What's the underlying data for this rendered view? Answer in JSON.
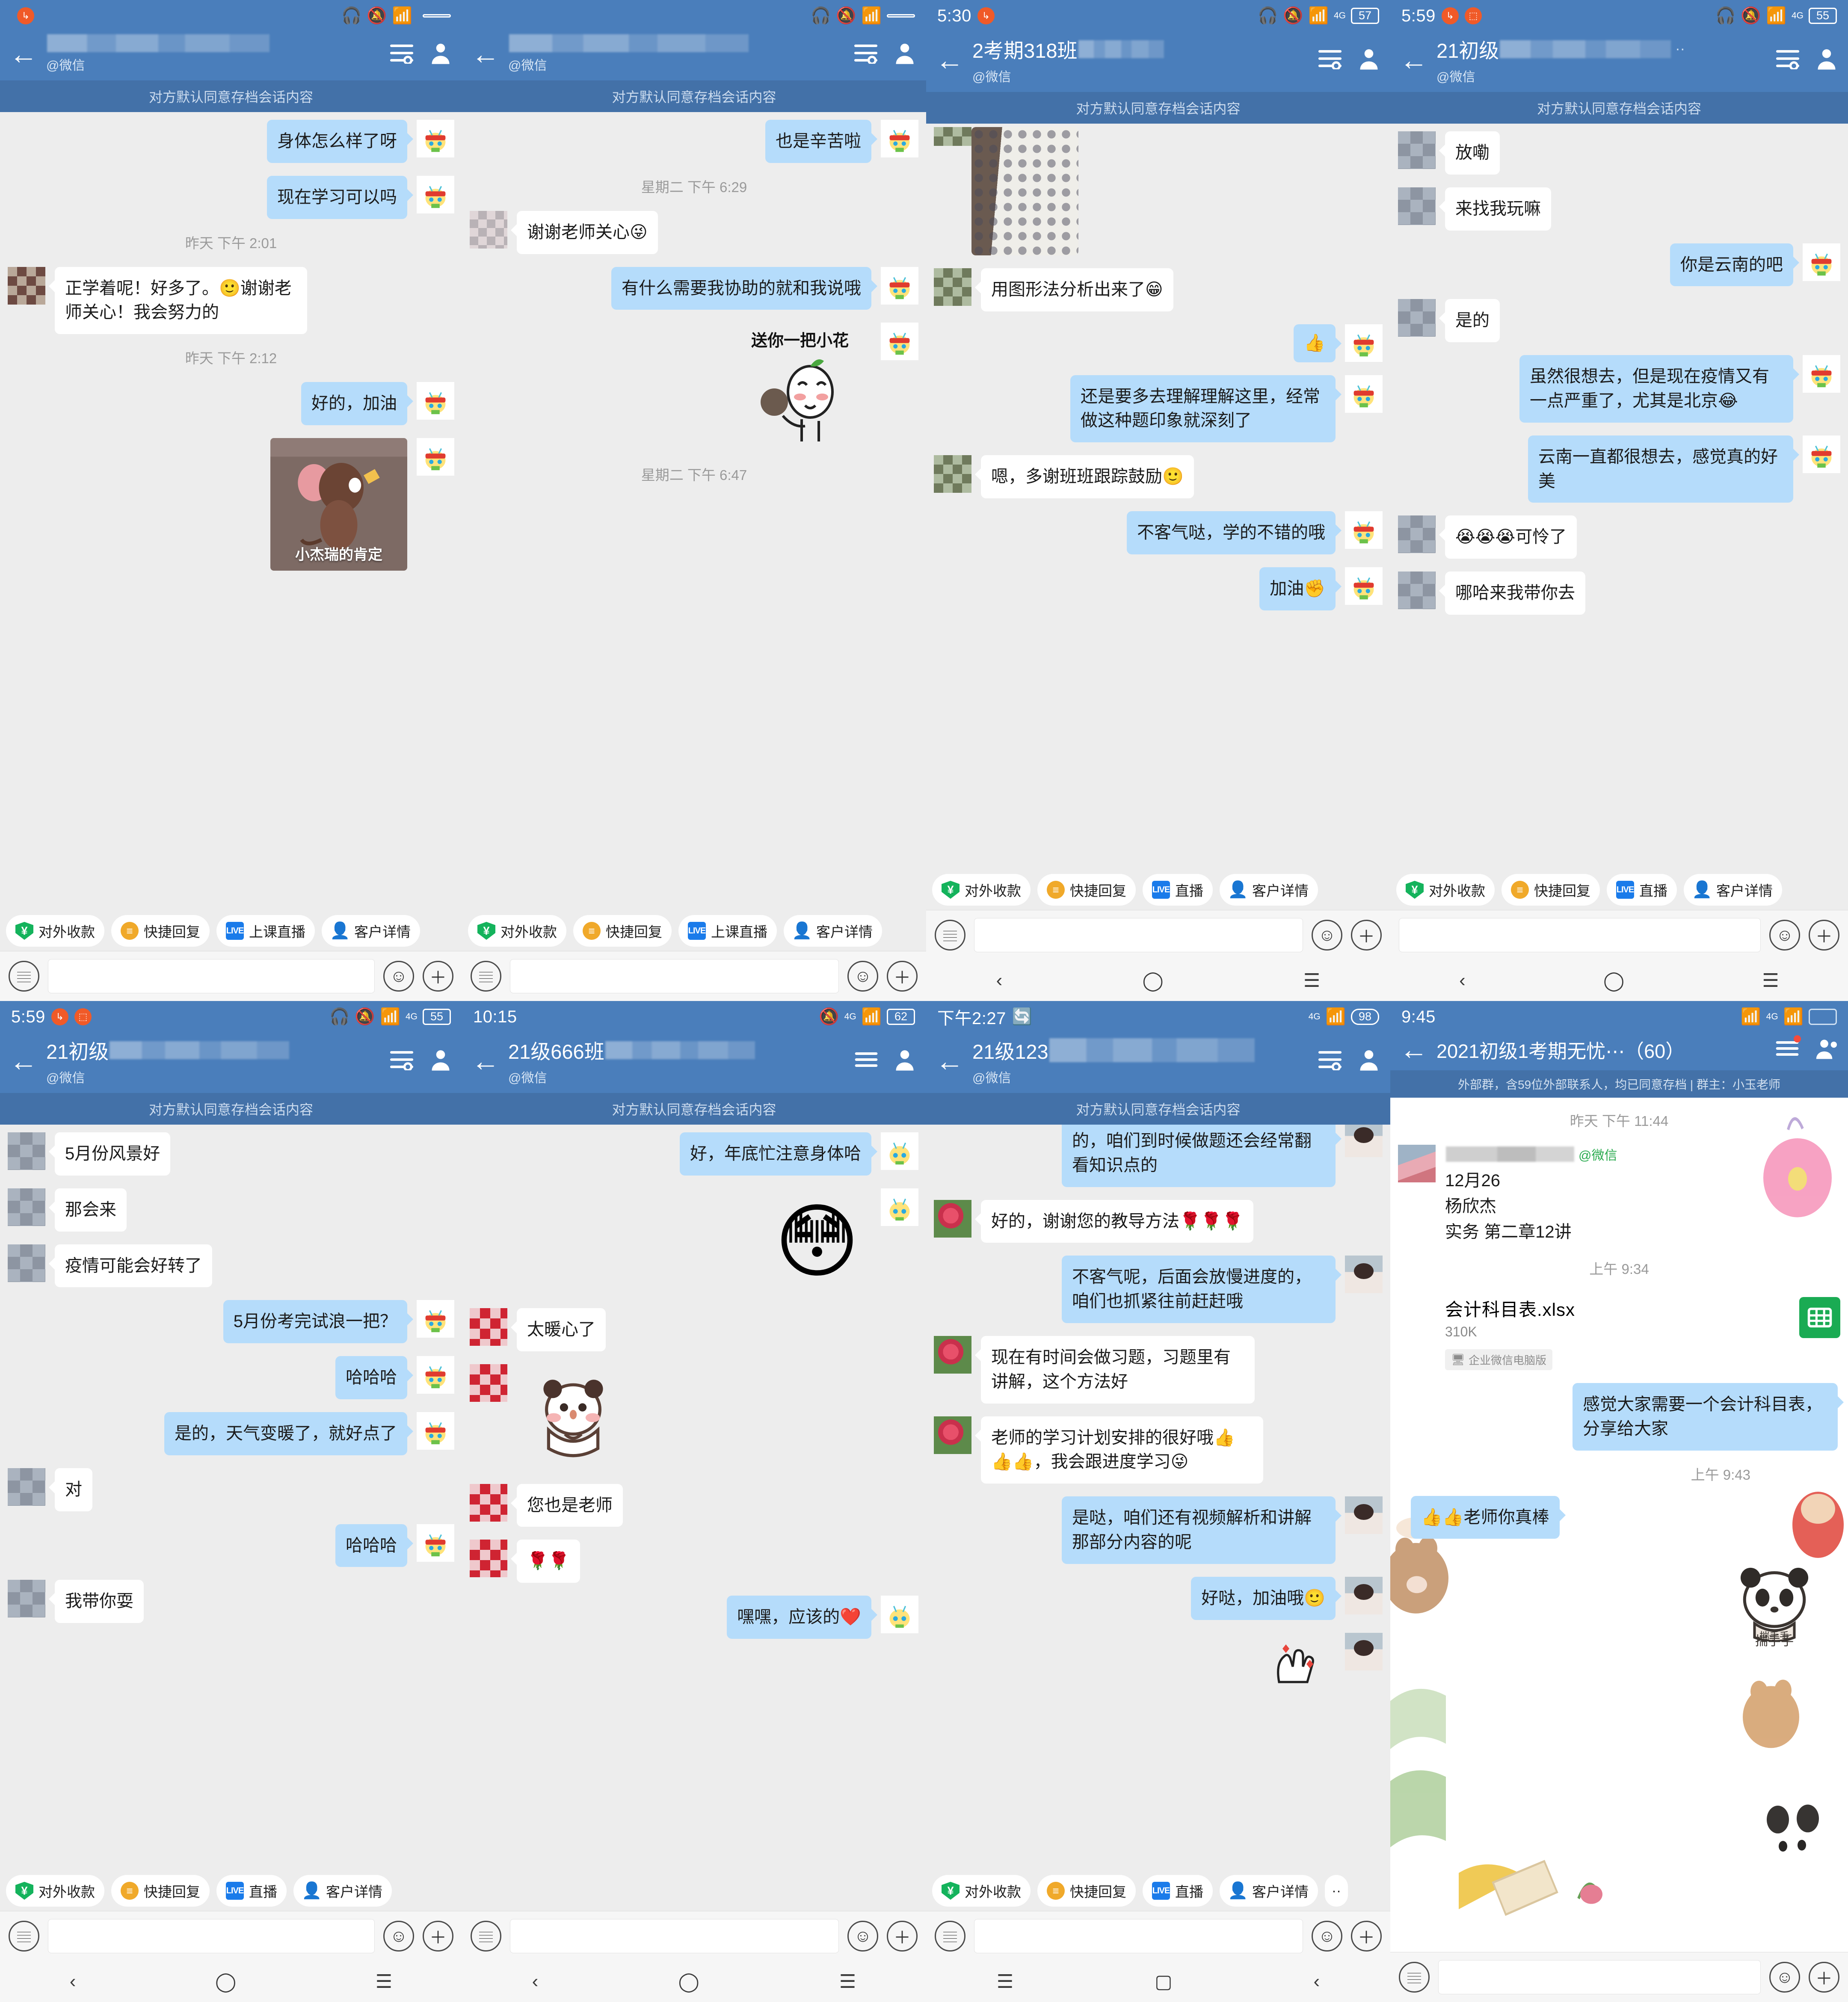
{
  "common": {
    "archive_notice": "对方默认同意存档会话内容",
    "org_handle": "@微信",
    "quick_actions": [
      {
        "label": "对外收款",
        "icon": "pay-shield-icon",
        "glyph": "¥"
      },
      {
        "label": "快捷回复",
        "icon": "quick-reply-icon",
        "glyph": "≡"
      },
      {
        "label": "上课直播",
        "icon": "live-icon",
        "glyph": "LIVE"
      },
      {
        "label": "客户详情",
        "icon": "customer-detail-icon",
        "glyph": "👤"
      }
    ],
    "quick_actions_short": [
      {
        "label": "对外收款",
        "icon": "pay-shield-icon",
        "glyph": "¥"
      },
      {
        "label": "快捷回复",
        "icon": "quick-reply-icon",
        "glyph": "≡"
      },
      {
        "label": "直播",
        "icon": "live-icon",
        "glyph": "LIVE"
      },
      {
        "label": "客户详情",
        "icon": "customer-detail-icon",
        "glyph": "👤"
      }
    ],
    "input_placeholder": "",
    "colors": {
      "header_blue": "#4a7ebb",
      "archive_blue": "#4371a8",
      "out_bubble": "#b5dcfb",
      "in_bubble": "#ffffff",
      "chat_bg": "#ededed",
      "accent_orange": "#f05a28",
      "pay_green": "#14b35c",
      "quick_yellow": "#f0a92a",
      "live_blue": "#1a7bea",
      "file_green": "#1aab53"
    }
  },
  "panels": [
    {
      "id": "panel-1",
      "status": {
        "time": "",
        "battery": "",
        "network": ""
      },
      "title": "",
      "subtitle": "@微信",
      "messages": [
        {
          "dir": "out",
          "type": "text",
          "text": "身体怎么样了呀"
        },
        {
          "dir": "out",
          "type": "text",
          "text": "现在学习可以吗"
        },
        {
          "type": "time",
          "text": "昨天  下午 2:01"
        },
        {
          "dir": "in",
          "type": "text",
          "text": "正学着呢！好多了。🙂谢谢老师关心！我会努力的"
        },
        {
          "type": "time",
          "text": "昨天  下午 2:12"
        },
        {
          "dir": "out",
          "type": "text",
          "text": "好的，加油"
        },
        {
          "dir": "out",
          "type": "image",
          "caption": "小杰瑞的肯定"
        }
      ]
    },
    {
      "id": "panel-2",
      "status": {
        "time": "",
        "battery": "",
        "network": ""
      },
      "title": "",
      "subtitle": "@微信",
      "messages": [
        {
          "dir": "out",
          "type": "text",
          "text": "也是辛苦啦"
        },
        {
          "type": "time",
          "text": "星期二  下午 6:29"
        },
        {
          "dir": "in",
          "type": "text",
          "text": "谢谢老师关心😜"
        },
        {
          "dir": "out",
          "type": "text",
          "text": "有什么需要我协助的就和我说哦"
        },
        {
          "dir": "out",
          "type": "sticker",
          "caption": "送你一把小花"
        },
        {
          "type": "time",
          "text": "星期二  下午 6:47"
        }
      ]
    },
    {
      "id": "panel-3",
      "status": {
        "time": "5:30",
        "battery": "57",
        "network": "4G"
      },
      "title": "2考期318班",
      "subtitle": "@微信",
      "messages": [
        {
          "dir": "in",
          "type": "photo"
        },
        {
          "dir": "in",
          "type": "text",
          "text": "用图形法分析出来了😁"
        },
        {
          "dir": "out",
          "type": "text",
          "text": "👍"
        },
        {
          "dir": "out",
          "type": "text",
          "text": "还是要多去理解理解这里，经常做这种题印象就深刻了"
        },
        {
          "dir": "in",
          "type": "text",
          "text": "嗯，多谢班班跟踪鼓励🙂"
        },
        {
          "dir": "out",
          "type": "text",
          "text": "不客气哒，学的不错的哦"
        },
        {
          "dir": "out",
          "type": "text",
          "text": "加油✊"
        }
      ]
    },
    {
      "id": "panel-4",
      "status": {
        "time": "5:59",
        "battery": "55",
        "network": "4G"
      },
      "title": "21初级",
      "subtitle": "@微信",
      "messages": [
        {
          "dir": "in",
          "type": "text",
          "text": "放嘞"
        },
        {
          "dir": "in",
          "type": "text",
          "text": "来找我玩嘛"
        },
        {
          "dir": "out",
          "type": "text",
          "text": "你是云南的吧"
        },
        {
          "dir": "in",
          "type": "text",
          "text": "是的"
        },
        {
          "dir": "out",
          "type": "text",
          "text": "虽然很想去，但是现在疫情又有一点严重了，尤其是北京😂"
        },
        {
          "dir": "out",
          "type": "text",
          "text": "云南一直都很想去，感觉真的好美"
        },
        {
          "dir": "in",
          "type": "text",
          "text": "😭😭😭可怜了"
        },
        {
          "dir": "in",
          "type": "text",
          "text": "哪哈来我带你去"
        }
      ]
    },
    {
      "id": "panel-5",
      "status": {
        "time": "5:59",
        "battery": "55",
        "network": "4G"
      },
      "title": "21初级",
      "subtitle": "@微信",
      "messages": [
        {
          "dir": "in",
          "type": "text",
          "text": "5月份风景好"
        },
        {
          "dir": "in",
          "type": "text",
          "text": "那会来"
        },
        {
          "dir": "in",
          "type": "text",
          "text": "疫情可能会好转了"
        },
        {
          "dir": "out",
          "type": "text",
          "text": "5月份考完试浪一把？"
        },
        {
          "dir": "out",
          "type": "text",
          "text": "哈哈哈"
        },
        {
          "dir": "out",
          "type": "text",
          "text": "是的，天气变暖了，就好点了"
        },
        {
          "dir": "in",
          "type": "text",
          "text": "对"
        },
        {
          "dir": "out",
          "type": "text",
          "text": "哈哈哈"
        },
        {
          "dir": "in",
          "type": "text",
          "text": "我带你耍"
        }
      ]
    },
    {
      "id": "panel-6",
      "status": {
        "time": "10:15",
        "battery": "62",
        "network": "4G"
      },
      "title": "21级666班",
      "subtitle": "@微信",
      "messages": [
        {
          "dir": "out",
          "type": "text",
          "text": "好，年底忙注意身体哈"
        },
        {
          "dir": "out",
          "type": "sticker",
          "caption": "😳"
        },
        {
          "dir": "in",
          "type": "text",
          "text": "太暖心了"
        },
        {
          "dir": "in",
          "type": "sticker",
          "caption": "panda"
        },
        {
          "dir": "in",
          "type": "text",
          "text": "您也是老师"
        },
        {
          "dir": "in",
          "type": "text",
          "text": "🌹🌹"
        },
        {
          "dir": "out",
          "type": "text",
          "text": "嘿嘿，应该的❤️"
        }
      ]
    },
    {
      "id": "panel-7",
      "status": {
        "time": "下午2:27",
        "battery": "98",
        "network": "4G"
      },
      "title": "21级123",
      "subtitle": "@微信",
      "messages": [
        {
          "dir": "out",
          "type": "text",
          "text": "的，咱们到时候做题还会经常翻看知识点的"
        },
        {
          "dir": "in",
          "type": "text",
          "text": "好的，谢谢您的教导方法🌹🌹🌹"
        },
        {
          "dir": "out",
          "type": "text",
          "text": "不客气呢，后面会放慢进度的，咱们也抓紧往前赶赶哦"
        },
        {
          "dir": "in",
          "type": "text",
          "text": "现在有时间会做习题，习题里有讲解，这个方法好"
        },
        {
          "dir": "in",
          "type": "text",
          "text": "老师的学习计划安排的很好哦👍👍👍，我会跟进度学习😜"
        },
        {
          "dir": "out",
          "type": "text",
          "text": "是哒，咱们还有视频解析和讲解那部分内容的呢"
        },
        {
          "dir": "out",
          "type": "text",
          "text": "好哒，加油哦🙂"
        },
        {
          "dir": "out",
          "type": "sticker",
          "caption": "hand"
        }
      ]
    },
    {
      "id": "panel-8",
      "status": {
        "time": "9:45",
        "battery": "",
        "network": "4G"
      },
      "title": "2021初级1考期无忧⋯（60）",
      "group_notice": "外部群，含59位外部联系人，均已同意存档 | 群主：小玉老师",
      "messages": [
        {
          "type": "time",
          "text": "昨天  下午 11:44"
        },
        {
          "dir": "in",
          "type": "card",
          "source": "@微信",
          "lines": [
            "12月26",
            "杨欣杰",
            "实务  第二章12讲"
          ]
        },
        {
          "type": "time",
          "text": "上午 9:34"
        },
        {
          "dir": "in",
          "type": "file",
          "name": "会计科目表.xlsx",
          "size": "310K",
          "source": "企业微信电脑版"
        },
        {
          "dir": "out",
          "type": "text",
          "text": "感觉大家需要一个会计科目表，分享给大家"
        },
        {
          "type": "time",
          "text": "上午 9:43",
          "side": "right"
        },
        {
          "dir": "in",
          "type": "text",
          "text": "👍👍老师你真棒"
        },
        {
          "dir": "in",
          "type": "sticker",
          "caption": "揣手手"
        }
      ]
    }
  ]
}
